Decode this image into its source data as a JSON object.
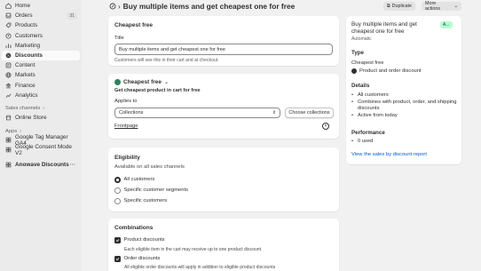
{
  "sidebar": {
    "items": [
      {
        "label": "Home",
        "icon": "home-icon"
      },
      {
        "label": "Orders",
        "icon": "orders-icon",
        "badge": "31"
      },
      {
        "label": "Products",
        "icon": "products-icon"
      },
      {
        "label": "Customers",
        "icon": "customers-icon"
      },
      {
        "label": "Marketing",
        "icon": "marketing-icon"
      },
      {
        "label": "Discounts",
        "icon": "discount-icon",
        "active": true
      },
      {
        "label": "Content",
        "icon": "content-icon"
      },
      {
        "label": "Markets",
        "icon": "markets-icon"
      },
      {
        "label": "Finance",
        "icon": "finance-icon"
      },
      {
        "label": "Analytics",
        "icon": "analytics-icon"
      }
    ],
    "sales_channels_label": "Sales channels",
    "online_store": "Online Store",
    "apps_label": "Apps",
    "apps": [
      "Google Tag Manager GA4",
      "Google Consent Mode V2"
    ],
    "app_footer": "Anowave Discounts"
  },
  "header": {
    "title": "Buy multiple items and get cheapest one for free",
    "duplicate": "Duplicate",
    "more_actions": "More actions"
  },
  "title_card": {
    "heading": "Cheapest free",
    "title_label": "Title",
    "title_value": "Buy multiple items and get cheapest one for free",
    "help": "Customers will see this in their cart and at checkout."
  },
  "app_card": {
    "name": "Cheapest free",
    "subtitle": "Get cheapest product in cart for free",
    "applies_label": "Applies to",
    "applies_value": "Collections",
    "choose_button": "Choose collections",
    "collection_item": "Frontpage"
  },
  "eligibility": {
    "heading": "Eligibility",
    "sub": "Available on all sales channels",
    "options": [
      "All customers",
      "Specific customer segments",
      "Specific customers"
    ],
    "selected": 0
  },
  "combinations": {
    "heading": "Combinations",
    "items": [
      {
        "label": "Product discounts",
        "help": "Each eligible item in the cart may receive up to one product discount"
      },
      {
        "label": "Order discounts",
        "help": "All eligible order discounts will apply in addition to eligible product discounts"
      }
    ]
  },
  "summary": {
    "title": "Buy multiple items and get cheapest one for free",
    "status_badge": "A...",
    "method": "Automatic",
    "type_heading": "Type",
    "type_value": "Cheapest free",
    "type_detail": "Product and order discount",
    "details_heading": "Details",
    "details": [
      "All customers",
      "Combines with product, order, and shipping discounts",
      "Active from today"
    ],
    "performance_heading": "Performance",
    "performance_value": "0 used",
    "report_link": "View the sales by discount report"
  },
  "colors": {
    "accent_green": "#29845a",
    "badge_green": "#b4fed2",
    "link_blue": "#005bd3",
    "background": "#f1f1f1",
    "sidebar": "#ebebeb"
  }
}
